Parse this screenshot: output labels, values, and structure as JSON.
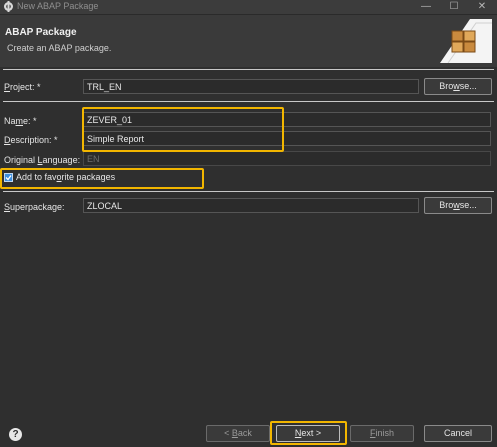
{
  "window": {
    "title": "New ABAP Package",
    "min_glyph": "—",
    "max_glyph": "☐",
    "close_glyph": "✕"
  },
  "header": {
    "title": "ABAP Package",
    "description": "Create an ABAP package.",
    "banner_icon": "package-banner-icon"
  },
  "form": {
    "project": {
      "label_prefix": "",
      "label_u": "P",
      "label_rest": "roject: *",
      "value": "TRL_EN",
      "browse_u": "w",
      "browse_pre": "Bro",
      "browse_post": "se..."
    },
    "name": {
      "label_pre": "Na",
      "label_u": "m",
      "label_rest": "e: *",
      "value": "ZEVER_01"
    },
    "description": {
      "label_u": "D",
      "label_rest": "escription: *",
      "value": "Simple Report"
    },
    "original_language": {
      "label_pre": "Original ",
      "label_u": "L",
      "label_rest": "anguage:",
      "value": "EN"
    },
    "favorite": {
      "label_pre": "Add to fav",
      "label_u": "o",
      "label_rest": "rite packages",
      "checked": true
    },
    "superpackage": {
      "label_u": "S",
      "label_rest": "uperpackage:",
      "value": "ZLOCAL",
      "browse_pre": "Bro",
      "browse_u": "w",
      "browse_post": "se..."
    }
  },
  "footer": {
    "help_glyph": "?",
    "back_pre": "< ",
    "back_u": "B",
    "back_rest": "ack",
    "next_pre": "",
    "next_u": "N",
    "next_rest": "ext >",
    "finish_u": "F",
    "finish_rest": "inish",
    "cancel_label": "Cancel"
  },
  "colors": {
    "highlight": "#f2b600",
    "checkbox": "#3e8ede"
  }
}
